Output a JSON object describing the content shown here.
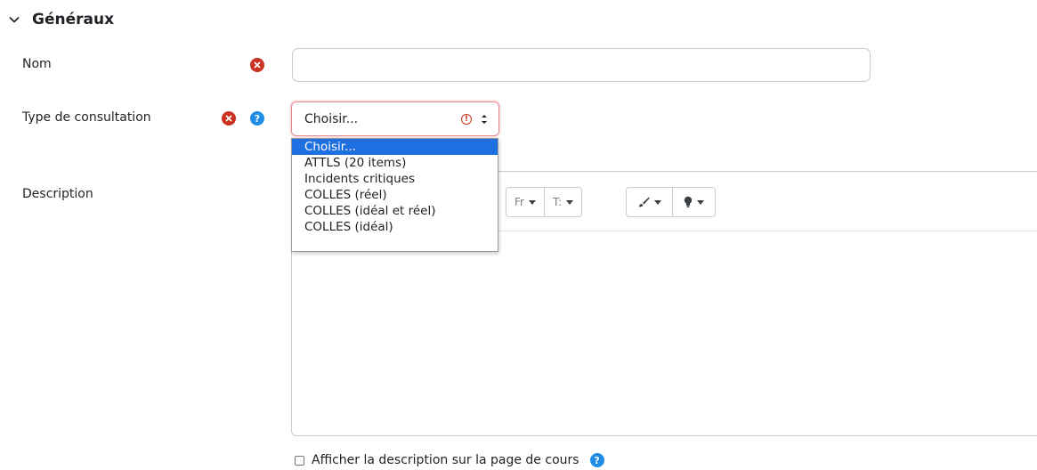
{
  "section": {
    "title": "Généraux",
    "icon": "chevron-down-icon"
  },
  "fields": {
    "name": {
      "label": "Nom",
      "value": "",
      "placeholder": ""
    },
    "type": {
      "label": "Type de consultation",
      "selected": "Choisir...",
      "warning_glyph": "!",
      "options": [
        "Choisir...",
        "ATTLS (20 items)",
        "Incidents critiques",
        "COLLES (réel)",
        "COLLES (idéal et réel)",
        "COLLES (idéal)"
      ]
    },
    "description": {
      "label": "Description",
      "toolbar": {
        "font_family": "Fr",
        "font_size": "T:",
        "brush_icon": "paint-brush-icon",
        "lightbulb_icon": "lightbulb-icon"
      }
    }
  },
  "show_description": {
    "label": "Afficher la description sur la page de cours",
    "checked": false
  },
  "icons": {
    "required": "required-icon",
    "help": "help-icon",
    "help_glyph": "?"
  },
  "colors": {
    "required": "#ca3120",
    "help": "#1f8ce6",
    "selected_option": "#1e70e0",
    "select_border": "#e48c91"
  }
}
